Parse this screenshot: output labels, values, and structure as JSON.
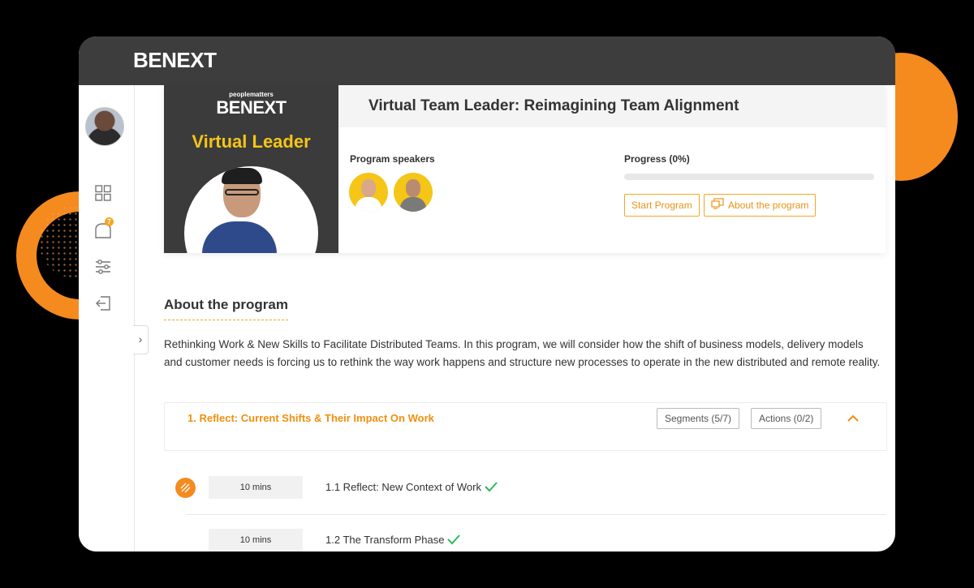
{
  "brand": {
    "logo_text": "BENEXT"
  },
  "sidebar": {
    "notification_count": "7",
    "items": [
      {
        "icon": "dashboard-grid-icon"
      },
      {
        "icon": "notification-icon"
      },
      {
        "icon": "sliders-icon"
      },
      {
        "icon": "logout-icon"
      }
    ]
  },
  "banner": {
    "sublogo": "peoplematters",
    "logo": "BENEXT",
    "title": "Virtual Leader"
  },
  "program": {
    "title": "Virtual Team Leader: Reimagining Team Alignment",
    "speakers_label": "Program speakers",
    "progress_label": "Progress (0%)",
    "progress_value": 0,
    "start_button": "Start Program",
    "about_button": "About the program"
  },
  "about": {
    "heading": "About the program",
    "description": "Rethinking Work & New Skills to Facilitate Distributed Teams. In this program, we will consider how the shift of business models, delivery models and customer needs is forcing us to rethink the way work happens and structure new processes to operate in the new distributed and remote reality."
  },
  "module": {
    "title": "1. Reflect: Current Shifts & Their Impact On Work",
    "segments_chip": "Segments (5/7)",
    "actions_chip": "Actions (0/2)"
  },
  "segments": [
    {
      "duration": "10 mins",
      "title": "1.1 Reflect: New Context of Work",
      "completed": true
    },
    {
      "duration": "10 mins",
      "title": "1.2 The Transform Phase",
      "completed": true
    }
  ],
  "colors": {
    "accent": "#f5a623",
    "deco_orange": "#f58a1f",
    "topbar": "#3d3d3d",
    "check": "#2eb85c"
  }
}
